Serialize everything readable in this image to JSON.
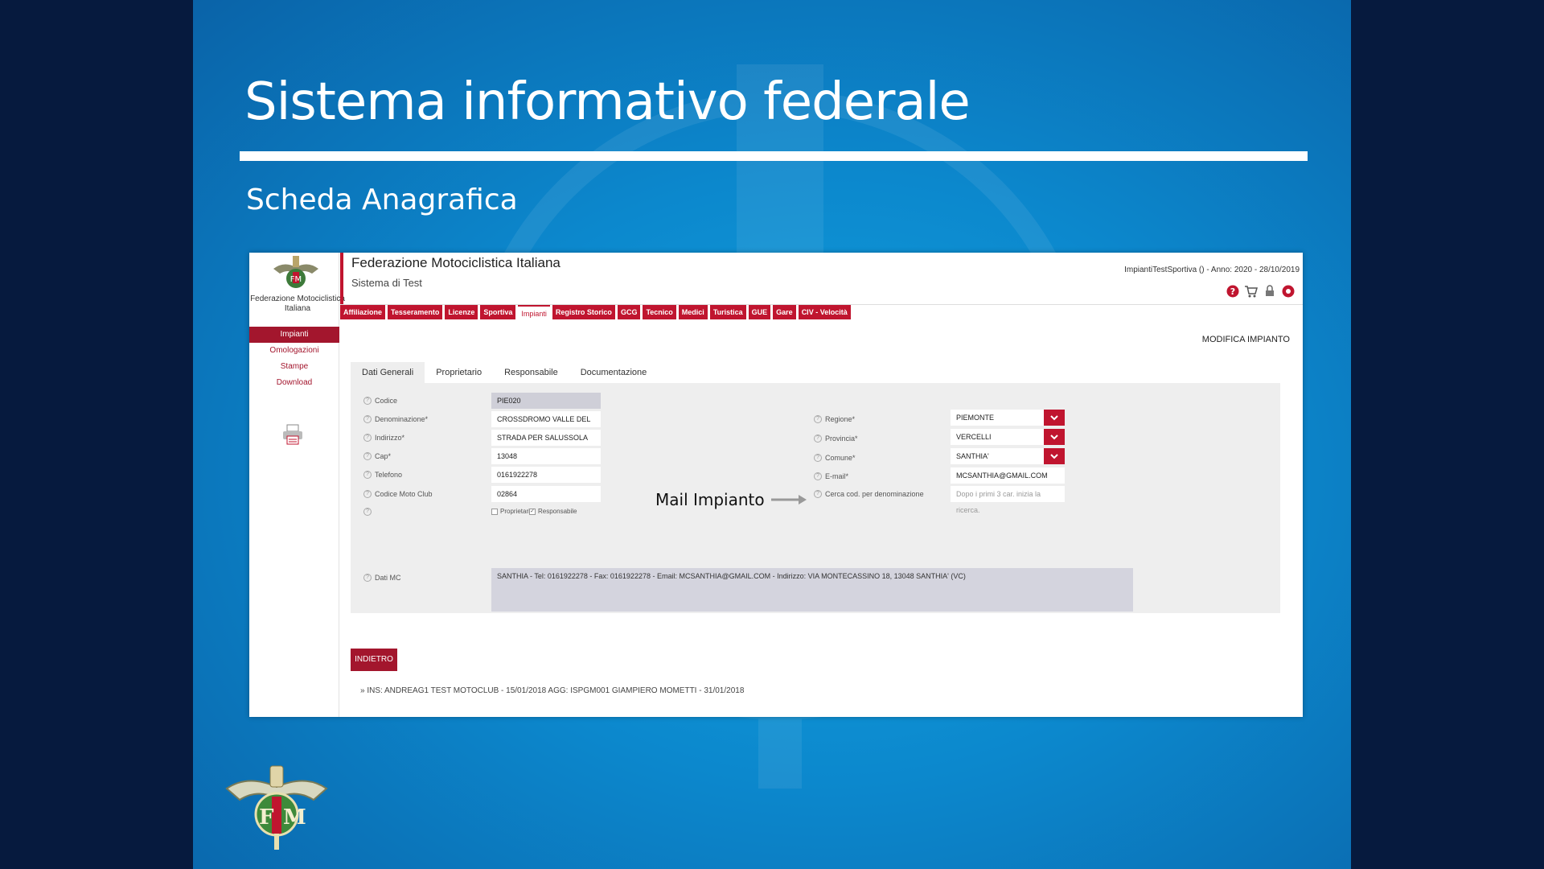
{
  "slide": {
    "title": "Sistema informativo federale",
    "subtitle": "Scheda Anagrafica",
    "callout": "Mail Impianto"
  },
  "colors": {
    "accent": "#c0152f",
    "sidebar_active": "#a3162d",
    "slide_bg": "#0c88cd"
  },
  "app": {
    "sidebar": {
      "org": "Federazione Motociclistica Italiana",
      "items": [
        {
          "label": "Impianti",
          "active": true
        },
        {
          "label": "Omologazioni"
        },
        {
          "label": "Stampe"
        },
        {
          "label": "Download"
        }
      ]
    },
    "header": {
      "org_name": "Federazione Motociclistica Italiana",
      "system": "Sistema di Test",
      "session": "ImpiantiTestSportiva () - Anno: 2020 - 28/10/2019",
      "icons": [
        "help-icon",
        "cart-icon",
        "lock-icon",
        "logout-icon"
      ]
    },
    "nav": [
      "Affiliazione",
      "Tesseramento",
      "Licenze",
      "Sportiva",
      "Impianti",
      "Registro Storico",
      "GCG",
      "Tecnico",
      "Medici",
      "Turistica",
      "GUE",
      "Gare",
      "CIV - Velocità"
    ],
    "nav_active": "Impianti",
    "page_action": "MODIFICA IMPIANTO",
    "subtabs": [
      "Dati Generali",
      "Proprietario",
      "Responsabile",
      "Documentazione"
    ],
    "form": {
      "left": [
        {
          "label": "Codice",
          "value": "PIE020"
        },
        {
          "label": "Denominazione*",
          "value": "CROSSDROMO VALLE DEL LUPO"
        },
        {
          "label": "Indirizzo*",
          "value": "STRADA PER SALUSSOLA"
        },
        {
          "label": "Cap*",
          "value": "13048"
        },
        {
          "label": "Telefono",
          "value": "0161922278"
        },
        {
          "label": "Codice Moto Club",
          "value": "02864"
        }
      ],
      "right": [
        {
          "label": "Regione*",
          "value": "PIEMONTE"
        },
        {
          "label": "Provincia*",
          "value": "VERCELLI"
        },
        {
          "label": "Comune*",
          "value": "SANTHIA'"
        },
        {
          "label": "E-mail*",
          "value": "MCSANTHIA@GMAIL.COM"
        },
        {
          "label": "Cerca cod. per denominazione",
          "placeholder": "Dopo i primi 3 car. inizia la ricerca."
        }
      ],
      "checkboxes": [
        {
          "label": "Proprietario",
          "checked": false
        },
        {
          "label": "Responsabile",
          "checked": true
        }
      ],
      "dati_mc_label": "Dati MC",
      "dati_mc": "SANTHIA - Tel: 0161922278 - Fax: 0161922278 - Email: MCSANTHIA@GMAIL.COM - Indirizzo: VIA MONTECASSINO 18, 13048 SANTHIA' (VC)"
    },
    "back_button": "INDIETRO",
    "audit": "» INS: ANDREAG1 TEST MOTOCLUB - 15/01/2018    AGG: ISPGM001 GIAMPIERO MOMETTI - 31/01/2018"
  }
}
